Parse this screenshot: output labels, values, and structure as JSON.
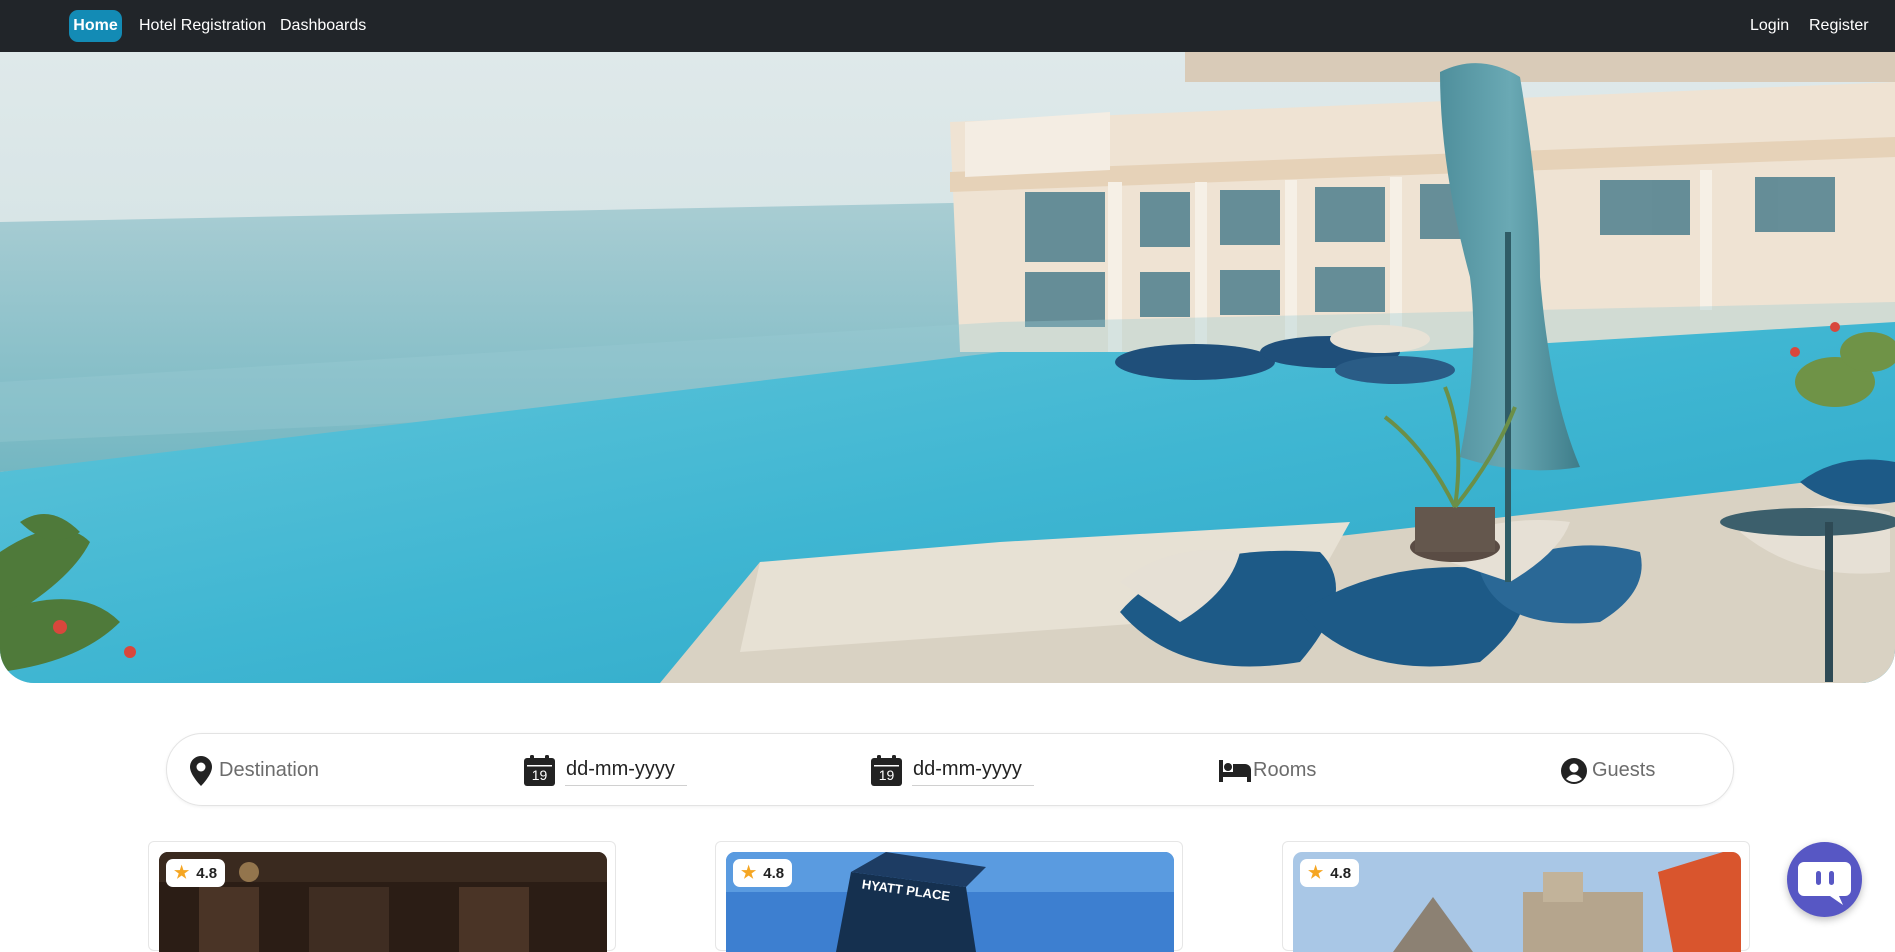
{
  "nav": {
    "home_label": "Home",
    "hotel_registration_label": "Hotel Registration",
    "dashboards_label": "Dashboards",
    "login_label": "Login",
    "register_label": "Register"
  },
  "search": {
    "destination_placeholder": "Destination",
    "checkin_value": "dd-mm-yyyy",
    "checkout_value": "dd-mm-yyyy",
    "rooms_placeholder": "Rooms",
    "guests_placeholder": "Guests",
    "calendar_day": "19",
    "icons": [
      "map-marker-icon",
      "calendar-icon",
      "calendar-icon",
      "bed-icon",
      "user-circle-icon"
    ]
  },
  "hotels": [
    {
      "rating": "4.8"
    },
    {
      "rating": "4.8",
      "sign_text": "HYATT PLACE"
    },
    {
      "rating": "4.8"
    }
  ],
  "colors": {
    "navbar_bg": "#212529",
    "home_accent": "#138bb5",
    "chat_button": "#5757c4",
    "star": "#f5a623"
  }
}
